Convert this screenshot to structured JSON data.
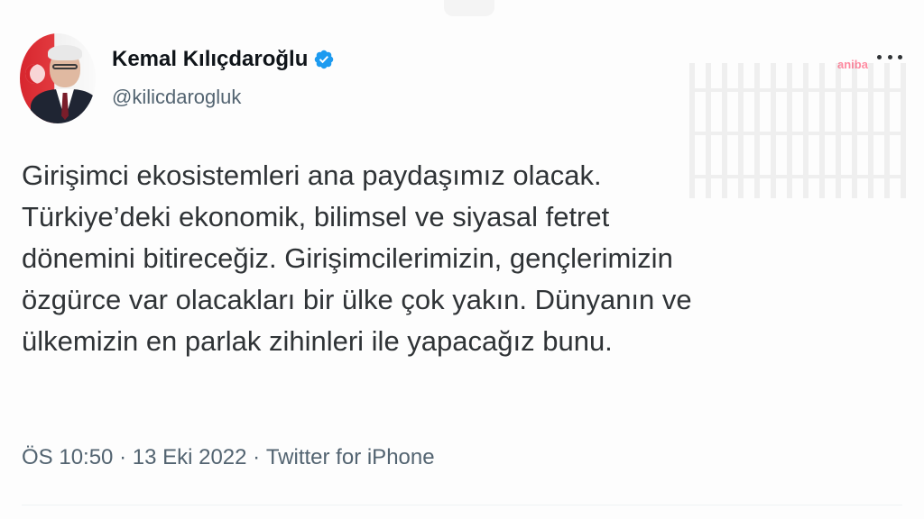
{
  "tweet": {
    "author": {
      "display_name": "Kemal Kılıçdaroğlu",
      "handle": "@kilicdarogluk",
      "verified": true,
      "verified_icon": "verified-badge-icon",
      "verified_color": "#1d9bf0",
      "avatar_icon": "profile-photo"
    },
    "watermark": "aniba",
    "more_icon": "more-options-icon",
    "text": "Girişimci ekosistemleri ana paydaşımız olacak.\nTürkiye’deki ekonomik, bilimsel ve siyasal fetret\ndönemini bitireceğiz. Girişimcilerimizin, gençlerimizin\nözgürce var olacakları bir ülke çok yakın. Dünyanın ve\nülkemizin en parlak zihinleri ile yapacağız bunu.",
    "meta": {
      "time": "ÖS 10:50",
      "separator": " · ",
      "date": "13 Eki 2022",
      "source": "Twitter for iPhone"
    }
  },
  "colors": {
    "text_primary": "#0f1419",
    "text_secondary": "#536471",
    "accent": "#1d9bf0"
  }
}
